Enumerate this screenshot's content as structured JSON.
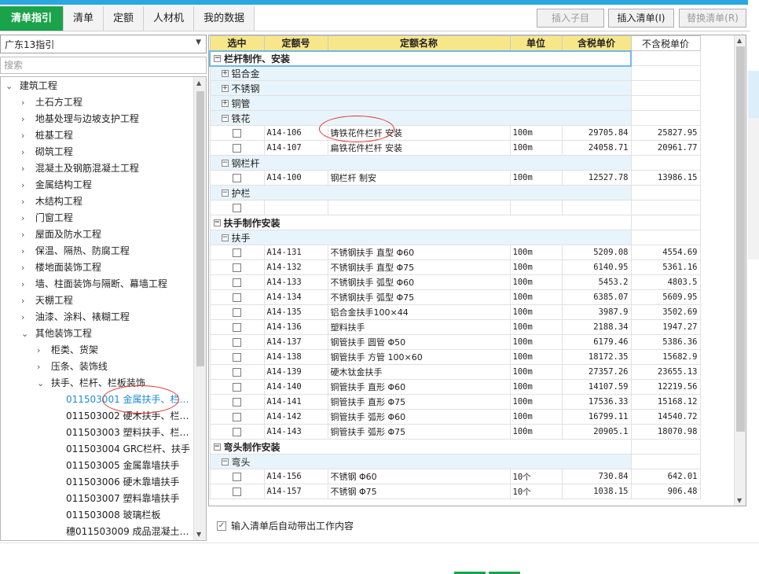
{
  "tabs": [
    {
      "label": "清单指引",
      "active": true
    },
    {
      "label": "清单",
      "active": false
    },
    {
      "label": "定额",
      "active": false
    },
    {
      "label": "人材机",
      "active": false
    },
    {
      "label": "我的数据",
      "active": false
    }
  ],
  "toolbar": {
    "insert_child": "插入子目",
    "insert_list": "插入清单(I)",
    "replace_list": "替换清单(R)"
  },
  "left": {
    "guide_select": "广东13指引",
    "search_placeholder": "搜索"
  },
  "tree": [
    {
      "label": "建筑工程",
      "level": 0,
      "arrow": "down"
    },
    {
      "label": "土石方工程",
      "level": 1,
      "arrow": "right"
    },
    {
      "label": "地基处理与边坡支护工程",
      "level": 1,
      "arrow": "right"
    },
    {
      "label": "桩基工程",
      "level": 1,
      "arrow": "right"
    },
    {
      "label": "砌筑工程",
      "level": 1,
      "arrow": "right"
    },
    {
      "label": "混凝土及钢筋混凝土工程",
      "level": 1,
      "arrow": "right"
    },
    {
      "label": "金属结构工程",
      "level": 1,
      "arrow": "right"
    },
    {
      "label": "木结构工程",
      "level": 1,
      "arrow": "right"
    },
    {
      "label": "门窗工程",
      "level": 1,
      "arrow": "right"
    },
    {
      "label": "屋面及防水工程",
      "level": 1,
      "arrow": "right"
    },
    {
      "label": "保温、隔热、防腐工程",
      "level": 1,
      "arrow": "right"
    },
    {
      "label": "楼地面装饰工程",
      "level": 1,
      "arrow": "right"
    },
    {
      "label": "墙、柱面装饰与隔断、幕墙工程",
      "level": 1,
      "arrow": "right"
    },
    {
      "label": "天棚工程",
      "level": 1,
      "arrow": "right"
    },
    {
      "label": "油漆、涂料、裱糊工程",
      "level": 1,
      "arrow": "right"
    },
    {
      "label": "其他装饰工程",
      "level": 1,
      "arrow": "down"
    },
    {
      "label": "柜类、货架",
      "level": 2,
      "arrow": "right"
    },
    {
      "label": "压条、装饰线",
      "level": 2,
      "arrow": "right"
    },
    {
      "label": "扶手、栏杆、栏板装饰",
      "level": 2,
      "arrow": "down"
    },
    {
      "code": "011503001",
      "label": "金属扶手、栏…",
      "level": 3,
      "selected": true
    },
    {
      "code": "011503002",
      "label": "硬木扶手、栏…",
      "level": 3
    },
    {
      "code": "011503003",
      "label": "塑料扶手、栏…",
      "level": 3
    },
    {
      "code": "011503004",
      "label": "GRC栏杆、扶手",
      "level": 3
    },
    {
      "code": "011503005",
      "label": "金属靠墙扶手",
      "level": 3
    },
    {
      "code": "011503006",
      "label": "硬木靠墙扶手",
      "level": 3
    },
    {
      "code": "011503007",
      "label": "塑料靠墙扶手",
      "level": 3
    },
    {
      "code": "011503008",
      "label": "玻璃栏板",
      "level": 3
    },
    {
      "code": "穗011503009",
      "label": "成品混凝土…",
      "level": 3
    }
  ],
  "grid": {
    "headers": [
      "选中",
      "定额号",
      "定额名称",
      "单位",
      "含税单价",
      "不含税单价"
    ],
    "rows": [
      {
        "type": "group",
        "level": 0,
        "sign": "−",
        "label": "栏杆制作、安装",
        "first": true
      },
      {
        "type": "group",
        "level": 1,
        "sign": "+",
        "label": "铝合金"
      },
      {
        "type": "group",
        "level": 1,
        "sign": "+",
        "label": "不锈钢"
      },
      {
        "type": "group",
        "level": 1,
        "sign": "+",
        "label": "铜管"
      },
      {
        "type": "group",
        "level": 1,
        "sign": "−",
        "label": "铁花"
      },
      {
        "type": "item",
        "code": "A14-106",
        "name": "铸铁花件栏杆 安装",
        "unit": "100m",
        "tax": "29705.84",
        "notax": "25827.95"
      },
      {
        "type": "item",
        "code": "A14-107",
        "name": "扁铁花件栏杆 安装",
        "unit": "100m",
        "tax": "24058.71",
        "notax": "20961.77"
      },
      {
        "type": "group",
        "level": 1,
        "sign": "−",
        "label": "钢栏杆"
      },
      {
        "type": "item",
        "code": "A14-100",
        "name": "钢栏杆 制安",
        "unit": "100m",
        "tax": "12527.78",
        "notax": "13986.15"
      },
      {
        "type": "group",
        "level": 1,
        "sign": "−",
        "label": "护栏"
      },
      {
        "type": "item",
        "code": "",
        "name": "",
        "unit": "",
        "tax": "",
        "notax": ""
      },
      {
        "type": "group",
        "level": 0,
        "sign": "−",
        "label": "扶手制作安装"
      },
      {
        "type": "group",
        "level": 1,
        "sign": "−",
        "label": "扶手"
      },
      {
        "type": "item",
        "code": "A14-131",
        "name": "不锈钢扶手 直型 Φ60",
        "unit": "100m",
        "tax": "5209.08",
        "notax": "4554.69"
      },
      {
        "type": "item",
        "code": "A14-132",
        "name": "不锈钢扶手 直型 Φ75",
        "unit": "100m",
        "tax": "6140.95",
        "notax": "5361.16"
      },
      {
        "type": "item",
        "code": "A14-133",
        "name": "不锈钢扶手 弧型 Φ60",
        "unit": "100m",
        "tax": "5453.2",
        "notax": "4803.5"
      },
      {
        "type": "item",
        "code": "A14-134",
        "name": "不锈钢扶手 弧型 Φ75",
        "unit": "100m",
        "tax": "6385.07",
        "notax": "5609.95"
      },
      {
        "type": "item",
        "code": "A14-135",
        "name": "铝合金扶手100×44",
        "unit": "100m",
        "tax": "3987.9",
        "notax": "3502.69"
      },
      {
        "type": "item",
        "code": "A14-136",
        "name": "塑料扶手",
        "unit": "100m",
        "tax": "2188.34",
        "notax": "1947.27"
      },
      {
        "type": "item",
        "code": "A14-137",
        "name": "钢管扶手 圆管 Φ50",
        "unit": "100m",
        "tax": "6179.46",
        "notax": "5386.36"
      },
      {
        "type": "item",
        "code": "A14-138",
        "name": "钢管扶手 方管 100×60",
        "unit": "100m",
        "tax": "18172.35",
        "notax": "15682.9"
      },
      {
        "type": "item",
        "code": "A14-139",
        "name": "硬木钛金扶手",
        "unit": "100m",
        "tax": "27357.26",
        "notax": "23655.13"
      },
      {
        "type": "item",
        "code": "A14-140",
        "name": "铜管扶手 直形 Φ60",
        "unit": "100m",
        "tax": "14107.59",
        "notax": "12219.56"
      },
      {
        "type": "item",
        "code": "A14-141",
        "name": "铜管扶手 直形 Φ75",
        "unit": "100m",
        "tax": "17536.33",
        "notax": "15168.12"
      },
      {
        "type": "item",
        "code": "A14-142",
        "name": "铜管扶手 弧形 Φ60",
        "unit": "100m",
        "tax": "16799.11",
        "notax": "14540.72"
      },
      {
        "type": "item",
        "code": "A14-143",
        "name": "铜管扶手 弧形 Φ75",
        "unit": "100m",
        "tax": "20905.1",
        "notax": "18070.98"
      },
      {
        "type": "group",
        "level": 0,
        "sign": "−",
        "label": "弯头制作安装"
      },
      {
        "type": "group",
        "level": 1,
        "sign": "−",
        "label": "弯头"
      },
      {
        "type": "item",
        "code": "A14-156",
        "name": "不锈钢 Φ60",
        "unit": "10个",
        "tax": "730.84",
        "notax": "642.01"
      },
      {
        "type": "item",
        "code": "A14-157",
        "name": "不锈钢 Φ75",
        "unit": "10个",
        "tax": "1038.15",
        "notax": "906.48"
      }
    ]
  },
  "bottom": {
    "auto_content_label": "输入清单后自动带出工作内容",
    "checked": true
  }
}
